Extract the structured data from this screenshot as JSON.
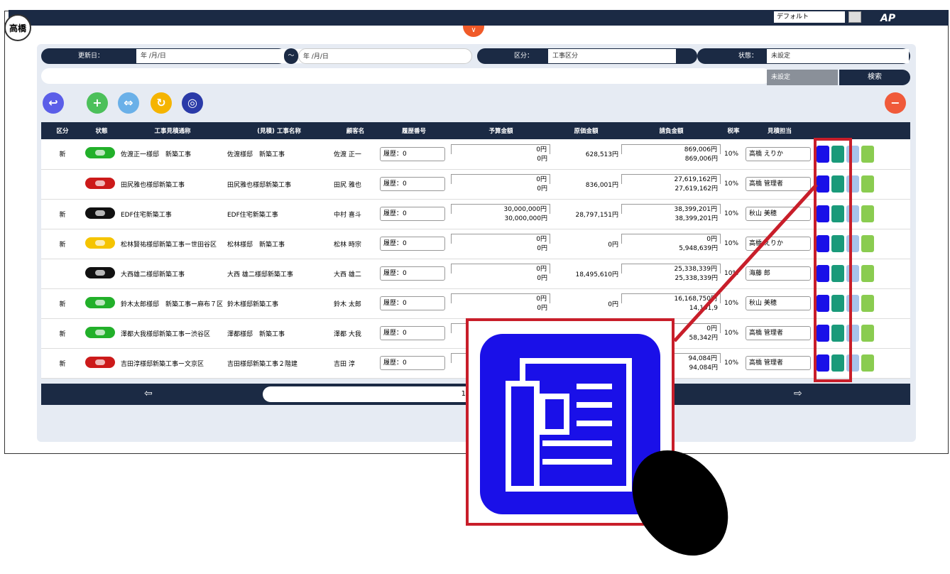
{
  "user": "高橋",
  "top": {
    "select": "デフォルト",
    "logo": "AP"
  },
  "filters": {
    "updated_label": "更新日：",
    "date_placeholder": "年 /月/日",
    "range_sep": "〜",
    "category_label": "区分：",
    "category_value": "工事区分",
    "status_label": "状態：",
    "status_value": "未設定",
    "sub_status": "未設定",
    "search": "検索"
  },
  "columns": [
    "区分",
    "状態",
    "工事見積通称",
    "(見積) 工事名称",
    "顧客名",
    "履歴番号",
    "予算金額",
    "原価金額",
    "請負金額",
    "税率",
    "見積担当"
  ],
  "rows": [
    {
      "kubun": "新",
      "status": "green",
      "name": "佐渡正一様邸　新築工事",
      "kname": "佐渡様邸　新築工事",
      "cust": "佐渡 正一",
      "hist": "履歴：0",
      "b1": "0円",
      "b2": "0円",
      "cost": "628,513円",
      "c1": "869,006円",
      "c2": "869,006円",
      "tax": "10%",
      "rep": "高橋 えりか"
    },
    {
      "kubun": "",
      "status": "red",
      "name": "田尻雅也様邸新築工事",
      "kname": "田尻雅也様邸新築工事",
      "cust": "田尻 雅也",
      "hist": "履歴：0",
      "b1": "0円",
      "b2": "0円",
      "cost": "836,001円",
      "c1": "27,619,162円",
      "c2": "27,619,162円",
      "tax": "10%",
      "rep": "高橋 管理者"
    },
    {
      "kubun": "新",
      "status": "black",
      "name": "EDF住宅新築工事",
      "kname": "EDF住宅新築工事",
      "cust": "中村 喜斗",
      "hist": "履歴：0",
      "b1": "30,000,000円",
      "b2": "30,000,000円",
      "cost": "28,797,151円",
      "c1": "38,399,201円",
      "c2": "38,399,201円",
      "tax": "10%",
      "rep": "秋山 美穂"
    },
    {
      "kubun": "新",
      "status": "yellow",
      "name": "松林賢祐様邸新築工事ー世田谷区",
      "kname": "松林様邸　新築工事",
      "cust": "松林 時宗",
      "hist": "履歴：0",
      "b1": "0円",
      "b2": "0円",
      "cost": "0円",
      "c1": "0円",
      "c2": "5,948,639円",
      "tax": "10%",
      "rep": "高橋 えりか"
    },
    {
      "kubun": "",
      "status": "black",
      "name": "大西雄二様邸新築工事",
      "kname": "大西 雄二様邸新築工事",
      "cust": "大西 雄二",
      "hist": "履歴：0",
      "b1": "0円",
      "b2": "0円",
      "cost": "18,495,610円",
      "c1": "25,338,339円",
      "c2": "25,338,339円",
      "tax": "10%",
      "rep": "海藤 郎"
    },
    {
      "kubun": "新",
      "status": "green",
      "name": "鈴木太郎様邸　新築工事ー麻布７区",
      "kname": "鈴木様邸新築工事",
      "cust": "鈴木 太郎",
      "hist": "履歴：0",
      "b1": "0円",
      "b2": "0円",
      "cost": "0円",
      "c1": "16,168,750円",
      "c2": "14,191,9",
      "tax": "10%",
      "rep": "秋山 美穂"
    },
    {
      "kubun": "新",
      "status": "green",
      "name": "澤都大我様邸新築工事ー渋谷区",
      "kname": "澤都様邸　新築工事",
      "cust": "澤都 大我",
      "hist": "履歴：0",
      "b1": "",
      "b2": "",
      "cost": "",
      "c1": "0円",
      "c2": "58,342円",
      "tax": "10%",
      "rep": "高橋 管理者"
    },
    {
      "kubun": "新",
      "status": "red",
      "name": "吉田淳様邸新築工事ー文京区",
      "kname": "吉田様邸新築工事２階建",
      "cust": "吉田 淳",
      "hist": "履歴：0",
      "b1": "",
      "b2": "",
      "cost": "",
      "c1": "94,084円",
      "c2": "94,084円",
      "tax": "10%",
      "rep": "高橋 管理者"
    }
  ],
  "pager": {
    "page": "1",
    "prev": "⇦",
    "next": "⇨"
  },
  "colors": {
    "green": "#22b02a",
    "red": "#cc1a1a",
    "black": "#111111",
    "yellow": "#f5c400"
  }
}
